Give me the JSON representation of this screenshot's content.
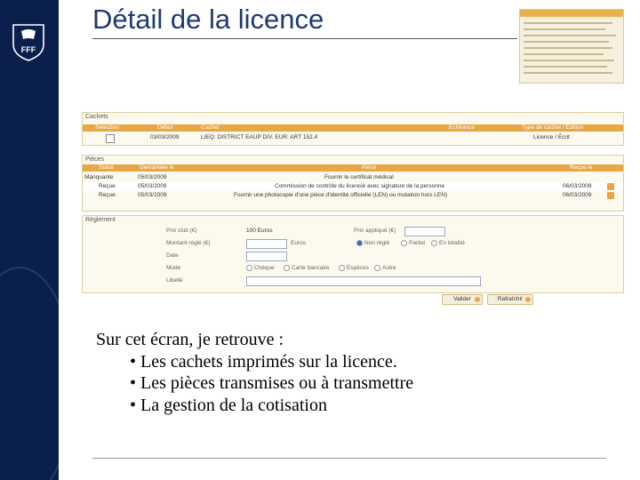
{
  "slide": {
    "title": "Détail de la licence",
    "brand_text": "FFF",
    "intro": "Sur cet écran, je retrouve :",
    "bullets": [
      "• Les cachets imprimés sur la licence.",
      "• Les pièces transmises ou à transmettre",
      "• La gestion de la cotisation"
    ]
  },
  "screenshot": {
    "cachets": {
      "title": "Cachets",
      "columns": [
        "Sélection",
        "Début",
        "Cachet",
        "Échéance",
        "Type de cachet / Édition"
      ],
      "rows": [
        [
          "",
          "03/03/2009",
          "LIEQ: DISTRICT EAUP DIV. EUR: ART 152.4",
          "",
          "Licence / Écrit"
        ]
      ]
    },
    "pieces": {
      "title": "Pièces",
      "columns": [
        "Statut",
        "Demandée le",
        "Pièce",
        "Reçue le"
      ],
      "rows": [
        [
          "Manquante",
          "05/03/2009",
          "Fournir le certificat médical",
          ""
        ],
        [
          "Reçue",
          "05/03/2009",
          "Commission de contrôle du licencié avec signature de la personne",
          "06/03/2009"
        ],
        [
          "Reçue",
          "05/03/2009",
          "Fournir une photocopie d'une pièce d'identité officielle (LEN) ou mutation hors LEN)",
          "06/03/2009"
        ]
      ]
    },
    "reglement": {
      "title": "Règlement",
      "labels": [
        "Prix club (€)",
        "Montant réglé (€)",
        "Date",
        "Mode",
        "Libellé"
      ],
      "prix_club_value": "100 Euros",
      "euros_unit": "Euros",
      "prix_applique_label": "Prix appliqué (€)",
      "status_options": [
        "Non réglé",
        "Partiel",
        "En totalité"
      ],
      "mode_options": [
        "Chèque",
        "Carte bancaire",
        "Espèces",
        "Autre"
      ]
    },
    "buttons": {
      "validate": "Valider",
      "refresh": "Rafraîchir"
    }
  }
}
